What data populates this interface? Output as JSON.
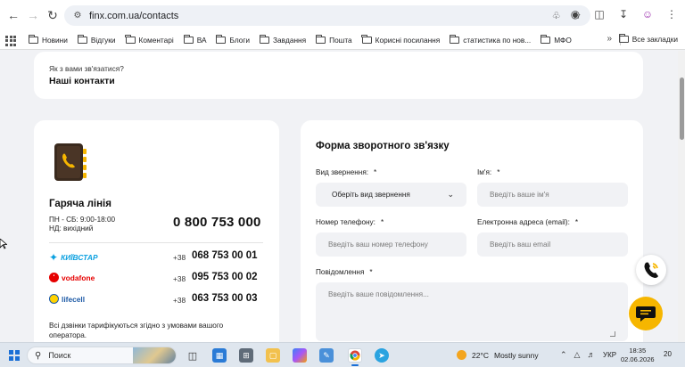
{
  "browser": {
    "url": "finx.com.ua/contacts",
    "bookmarks": [
      "Новини",
      "Відгуки",
      "Коментарі",
      "ВА",
      "Блоги",
      "Завдання",
      "Пошта",
      "Корисні посилання",
      "статистика по нов...",
      "МФО"
    ],
    "all_bookmarks_label": "Все закладки",
    "more_label": "»"
  },
  "header": {
    "eyebrow": "Як з вами зв'язатися?",
    "title": "Наші контакти"
  },
  "hotline": {
    "title": "Гаряча лінія",
    "hours_line1": "ПН - СБ: 9:00-18:00",
    "hours_line2": "НД: вихідний",
    "phone": "0 800 753 000",
    "operators": [
      {
        "name": "КИЇВСТАР",
        "prefix": "+38",
        "number": "068 753 00 01",
        "color": "#0aa0e0"
      },
      {
        "name": "vodafone",
        "prefix": "+38",
        "number": "095 753 00 02",
        "color": "#e60000"
      },
      {
        "name": "lifecell",
        "prefix": "+38",
        "number": "063 753 00 03",
        "color": "#1d5aa6"
      }
    ],
    "note": "Всі дзвінки тарифікуються згідно з умовами вашого оператора."
  },
  "form": {
    "title": "Форма зворотного зв'язку",
    "type_label": "Вид звернення:",
    "type_value": "Оберіть вид звернення",
    "name_label": "Ім'я:",
    "name_placeholder": "Введіть ваше ім'я",
    "phone_label": "Номер телефону:",
    "phone_placeholder": "Введіть ваш номер телефону",
    "email_label": "Електронна адреса (email):",
    "email_placeholder": "Введіть ваш email",
    "message_label": "Повідомлення",
    "message_placeholder": "Введіть ваше повідомлення...",
    "required_mark": "*"
  },
  "taskbar": {
    "search_placeholder": "Поиск",
    "weather_temp": "22°C",
    "weather_desc": "Mostly sunny",
    "language": "УКР",
    "time": "18:35",
    "date": "02.06.2026",
    "notifications": "20"
  },
  "colors": {
    "page_bg": "#f1f2f5",
    "card_bg": "#ffffff",
    "field_bg": "#f1f2f5",
    "accent_yellow": "#f6b600"
  }
}
